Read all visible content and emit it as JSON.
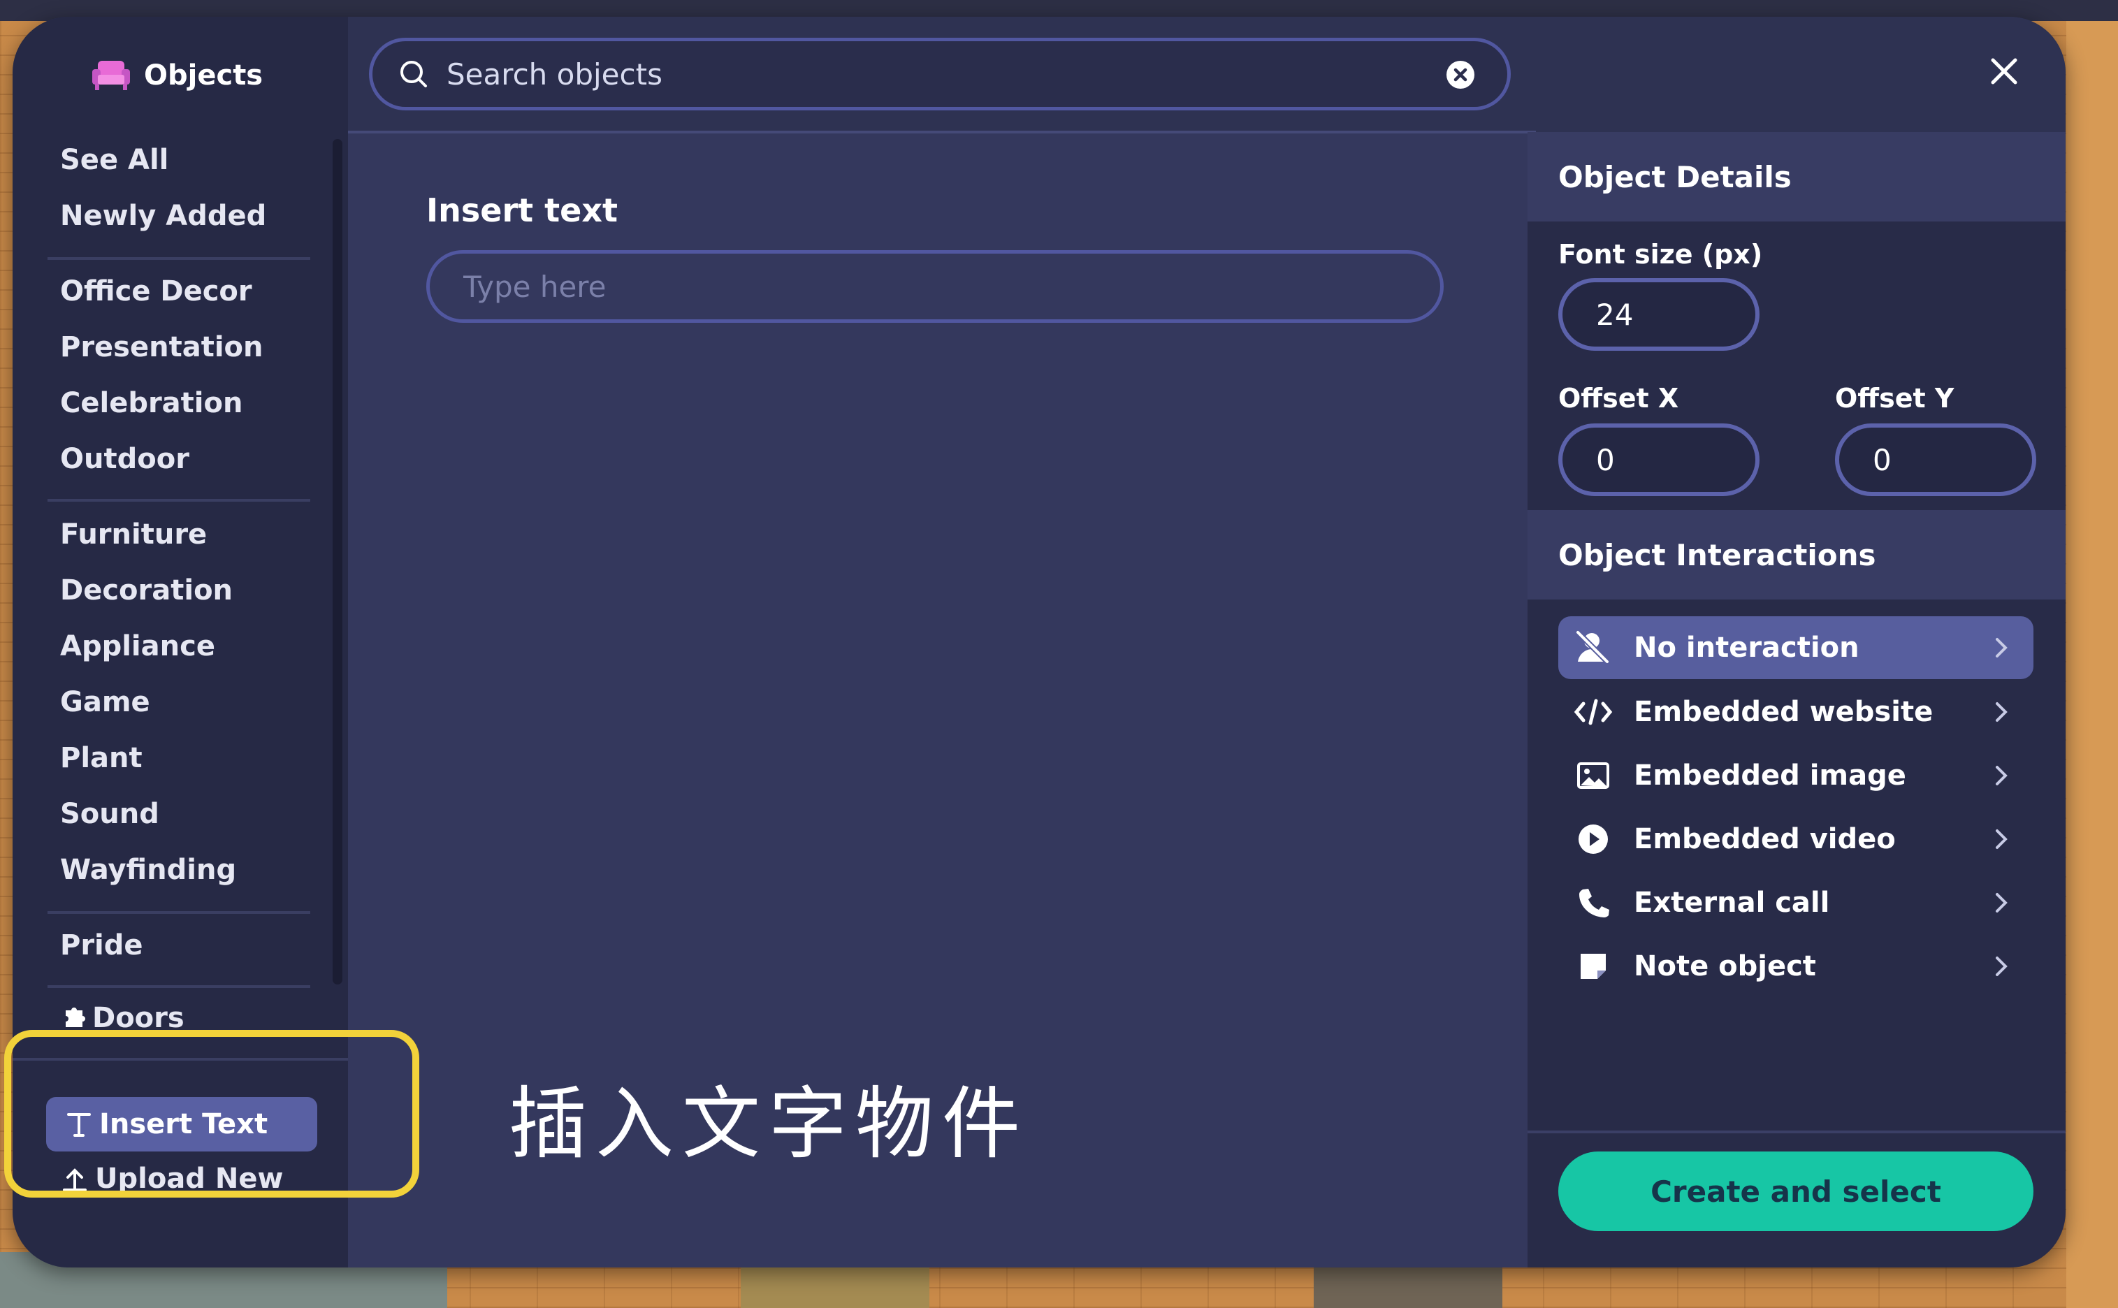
{
  "sidebar": {
    "title": "Objects",
    "items": [
      {
        "label": "See All"
      },
      {
        "label": "Newly Added"
      },
      {
        "label": "Office Decor"
      },
      {
        "label": "Presentation"
      },
      {
        "label": "Celebration"
      },
      {
        "label": "Outdoor"
      },
      {
        "label": "Furniture"
      },
      {
        "label": "Decoration"
      },
      {
        "label": "Appliance"
      },
      {
        "label": "Game"
      },
      {
        "label": "Plant"
      },
      {
        "label": "Sound"
      },
      {
        "label": "Wayfinding"
      },
      {
        "label": "Pride"
      },
      {
        "label": "Doors"
      }
    ],
    "insert_text": "Insert Text",
    "upload_new": "Upload New"
  },
  "search": {
    "placeholder": "Search objects",
    "value": ""
  },
  "main": {
    "title": "Insert text",
    "input_placeholder": "Type here",
    "input_value": ""
  },
  "details": {
    "header": "Object Details",
    "font_size_label": "Font size (px)",
    "font_size_value": "24",
    "offset_x_label": "Offset X",
    "offset_x_value": "0",
    "offset_y_label": "Offset Y",
    "offset_y_value": "0"
  },
  "interactions": {
    "header": "Object Interactions",
    "items": [
      {
        "label": "No interaction",
        "icon": "no-interaction-icon",
        "selected": true
      },
      {
        "label": "Embedded website",
        "icon": "code-icon",
        "selected": false
      },
      {
        "label": "Embedded image",
        "icon": "image-icon",
        "selected": false
      },
      {
        "label": "Embedded video",
        "icon": "play-icon",
        "selected": false
      },
      {
        "label": "External call",
        "icon": "phone-icon",
        "selected": false
      },
      {
        "label": "Note object",
        "icon": "note-icon",
        "selected": false
      }
    ]
  },
  "footer": {
    "create_label": "Create and select"
  },
  "annotation": {
    "caption": "插入文字物件",
    "highlight_color": "#f2d23a"
  },
  "colors": {
    "accent": "#17c6a5",
    "selected": "#575e9e",
    "panel": "#34385d"
  }
}
